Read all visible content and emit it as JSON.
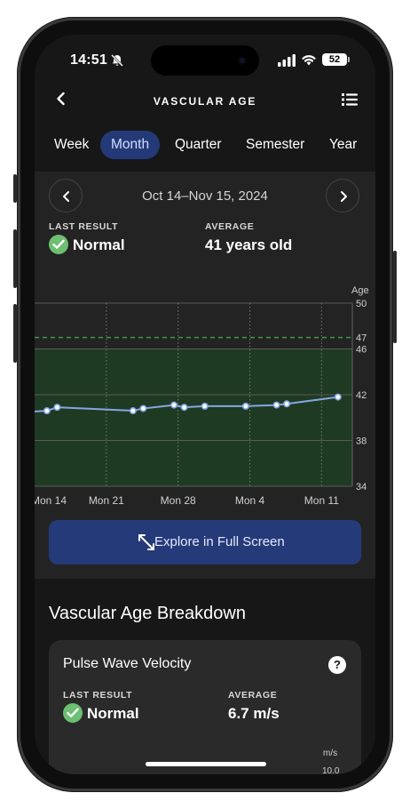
{
  "status": {
    "time": "14:51",
    "battery": "52"
  },
  "nav": {
    "title": "VASCULAR AGE"
  },
  "tabs": [
    {
      "label": "Week",
      "active": false
    },
    {
      "label": "Month",
      "active": true
    },
    {
      "label": "Quarter",
      "active": false
    },
    {
      "label": "Semester",
      "active": false
    },
    {
      "label": "Year",
      "active": false
    }
  ],
  "summary": {
    "range": "Oct 14–Nov 15, 2024",
    "last_result_label": "LAST RESULT",
    "last_result_value": "Normal",
    "average_label": "AVERAGE",
    "average_value": "41 years old"
  },
  "chart_data": {
    "type": "line",
    "ylabel": "Age",
    "y_ticks": [
      "50",
      "47",
      "46",
      "42",
      "38",
      "34"
    ],
    "ylim": [
      34,
      50
    ],
    "normal_band": [
      34,
      46
    ],
    "threshold": 47,
    "x_tick_labels": [
      "Mon 14",
      "Mon 21",
      "Mon 28",
      "Mon 4",
      "Mon 11"
    ],
    "x_tick_days": [
      0,
      7,
      14,
      21,
      28
    ],
    "x_range_days": [
      0,
      31
    ],
    "series": [
      {
        "values": [
          [
            -0.5,
            40.5
          ],
          [
            1.2,
            40.6
          ],
          [
            2.2,
            40.9
          ],
          [
            9.6,
            40.6
          ],
          [
            10.6,
            40.8
          ],
          [
            13.6,
            41.1
          ],
          [
            14.6,
            40.9
          ],
          [
            16.6,
            41.0
          ],
          [
            20.6,
            41.0
          ],
          [
            23.6,
            41.1
          ],
          [
            24.6,
            41.2
          ],
          [
            29.6,
            41.8
          ]
        ]
      }
    ],
    "colors": {
      "band": "#1f3a22",
      "line": "#86a6e4",
      "threshold": "#3f9d45",
      "grid": "#5a5a5a"
    }
  },
  "explore_label": "Explore in Full Screen",
  "breakdown": {
    "title": "Vascular Age Breakdown",
    "pwv": {
      "title": "Pulse Wave Velocity",
      "help": "?",
      "last_result_label": "LAST RESULT",
      "last_result_value": "Normal",
      "average_label": "AVERAGE",
      "average_value": "6.7 m/s",
      "unit": "m/s",
      "first_tick": "10.0"
    }
  },
  "icons": {
    "back": "chevron-left-icon",
    "menu": "list-icon",
    "prev": "chevron-left-icon",
    "next": "chevron-right-icon",
    "check": "checkmark-icon",
    "expand": "expand-arrows-icon",
    "help": "question-icon"
  }
}
